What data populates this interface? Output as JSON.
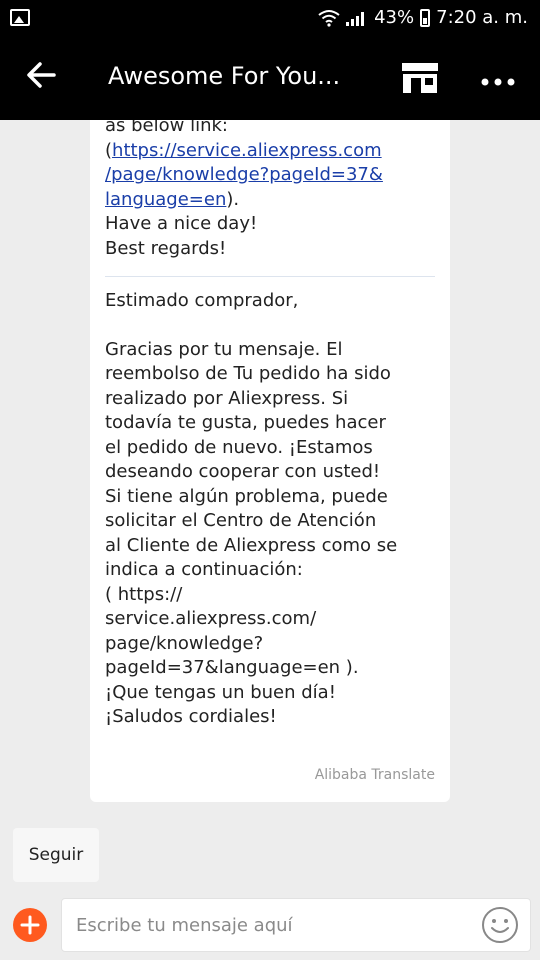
{
  "status_bar": {
    "battery": "43%",
    "time": "7:20 a. m."
  },
  "header": {
    "back_icon": "arrow-left-icon",
    "title": "Awesome For You...",
    "store_icon": "store-icon",
    "more_icon": "more-icon"
  },
  "message": {
    "english_tail": [
      "as below link:"
    ],
    "english_link_text": "https://service.aliexpress.com/page/knowledge?pageId=37&language=en",
    "english_link_lines": [
      "https://service.aliexpress.com",
      "/page/knowledge?pageId=37&",
      "language=en"
    ],
    "english_closing": [
      "Have a nice day!",
      "Best regards!"
    ],
    "spanish_greeting": "Estimado comprador,",
    "spanish_body": [
      "Gracias por tu mensaje. El",
      "reembolso de Tu pedido ha sido",
      "realizado por Aliexpress. Si",
      "todavía te gusta, puedes hacer",
      "el pedido de nuevo. ¡Estamos",
      "deseando cooperar con usted!",
      "Si tiene algún problema, puede",
      "solicitar el Centro de Atención",
      "al Cliente de Aliexpress como se",
      "indica a continuación:",
      "( https://",
      "service.aliexpress.com/",
      "page/knowledge?",
      "pageId=37&language=en ).",
      "¡Que tengas un buen día!",
      "¡Saludos cordiales!"
    ],
    "translation_credit": "Alibaba Translate"
  },
  "follow_button": "Seguir",
  "composer": {
    "plus_icon": "plus-icon",
    "placeholder": "Escribe tu mensaje aquí",
    "emoji_icon": "smiley-icon"
  },
  "colors": {
    "appbar_bg": "#000000",
    "link": "#1a3ea8",
    "accent": "#ff5a1f",
    "page_bg": "#ededed"
  }
}
